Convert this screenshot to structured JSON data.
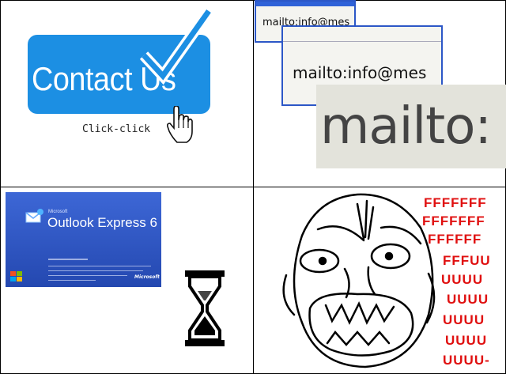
{
  "panel1": {
    "button_label": "Contact Us",
    "caption": "Click-click",
    "colors": {
      "button": "#1c8fe3",
      "check": "#1c8fe3"
    },
    "icons": [
      "checkmark-icon",
      "hand-pointer-icon"
    ]
  },
  "panel2": {
    "mailto_small": "mailto:info@mes",
    "mailto_medium": "mailto:info@mes",
    "mailto_large": "mailto:",
    "colors": {
      "window_border": "#2c57c7"
    }
  },
  "panel3": {
    "splash_brand": "Microsoft",
    "splash_title": "Outlook Express 6",
    "splash_footer_brand": "Microsoft",
    "icons": [
      "outlook-express-logo-icon",
      "windows-flag-icon",
      "hourglass-icon"
    ]
  },
  "panel4": {
    "rage_lines": [
      "FFFFFFF",
      "FFFFFFF",
      "FFFFFF",
      "FFFUU",
      "UUUU",
      "UUUU",
      "UUUU",
      "UUUU",
      "UUUU-"
    ],
    "colors": {
      "rage_text": "#e01010"
    },
    "icons": [
      "rage-face-icon"
    ]
  }
}
